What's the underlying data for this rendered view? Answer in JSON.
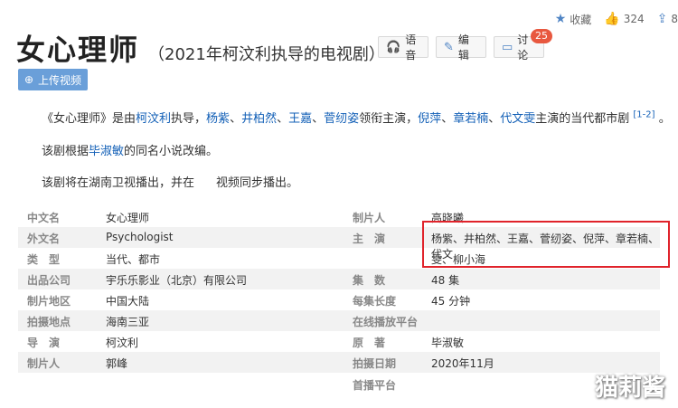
{
  "topbar": {
    "favorite": "收藏",
    "likes": "324",
    "share_partial": "8"
  },
  "title": {
    "main": "女心理师",
    "sub": "（2021年柯汶利执导的电视剧）"
  },
  "toolbar": {
    "voice": "语音",
    "edit": "编辑",
    "discuss": "讨论",
    "discuss_count": "25"
  },
  "upload_label": "上传视频",
  "intro": {
    "p1_a": "《女心理师》是由",
    "p1_director": "柯汶利",
    "p1_b": "执导，",
    "p1_lead1": "杨紫",
    "sep": "、",
    "p1_lead2": "井柏然",
    "p1_lead3": "王嘉",
    "p1_lead4": "菅纫姿",
    "p1_c": "领衔主演，",
    "p1_cast1": "倪萍",
    "p1_cast2": "章若楠",
    "p1_cast3": "代文雯",
    "p1_d": "主演的当代都市剧",
    "p1_ref": "[1-2]",
    "p1_end": "。",
    "p2_a": "该剧根据",
    "p2_author": "毕淑敏",
    "p2_b": "的同名小说改编。",
    "p3_a": "该剧将在湖南卫视播出，并在",
    "p3_b": "视频同步播出。"
  },
  "info": {
    "left": [
      {
        "label": "中文名",
        "value": "女心理师"
      },
      {
        "label": "外文名",
        "value": "Psychologist"
      },
      {
        "label": "类　型",
        "value": "当代、都市"
      },
      {
        "label": "出品公司",
        "value": "宇乐乐影业（北京）有限公司"
      },
      {
        "label": "制片地区",
        "value": "中国大陆"
      },
      {
        "label": "拍摄地点",
        "value": "海南三亚"
      },
      {
        "label": "导　演",
        "value": "柯汶利"
      },
      {
        "label": "制片人",
        "value": "郭峰"
      }
    ],
    "right": [
      {
        "label": "制片人",
        "value": "高晓曦"
      },
      {
        "label": "主　演",
        "value": "杨紫、井柏然、王嘉、菅纫姿、倪萍、章若楠、代文"
      },
      {
        "label": "",
        "value": "雯、柳小海"
      },
      {
        "label": "集　数",
        "value": "48 集"
      },
      {
        "label": "每集长度",
        "value": "45 分钟"
      },
      {
        "label": "在线播放平台",
        "value": ""
      },
      {
        "label": "原　著",
        "value": "毕淑敏"
      },
      {
        "label": "拍摄日期",
        "value": "2020年11月"
      },
      {
        "label": "首播平台",
        "value": ""
      }
    ]
  },
  "watermark": "猫莉酱",
  "colors": {
    "link": "#1360b7",
    "button": "#6a9fd9",
    "highlight_box": "#e0232b",
    "badge": "#e8583f"
  }
}
